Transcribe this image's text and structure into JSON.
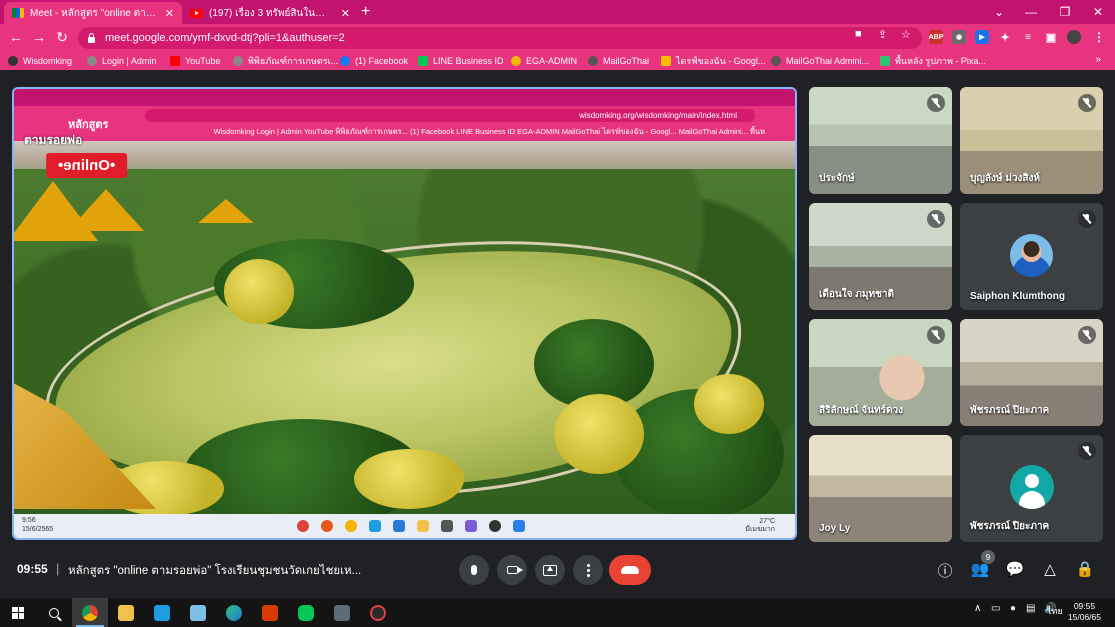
{
  "browser": {
    "tabs": [
      {
        "title": "Meet - หลักสูตร \"online ตามรอยพ่อ\"",
        "icon": "meet-icon",
        "active": true
      },
      {
        "title": "(197) เรื่อง 3 ทรัพย์สินในน้ำ - YouTube",
        "icon": "youtube-icon",
        "active": false
      }
    ],
    "new_tab": "+",
    "window_controls": [
      "⌄",
      "—",
      "❐",
      "✕"
    ],
    "url": "meet.google.com/ymf-dxvd-dtj?pli=1&authuser=2",
    "bookmarks": [
      {
        "label": "Wisdomking",
        "icon": "wisdomking-icon",
        "color": "#333333"
      },
      {
        "label": "Login | Admin",
        "icon": "globe-icon",
        "color": "#888888"
      },
      {
        "label": "YouTube",
        "icon": "youtube-icon",
        "color": "#ff0000"
      },
      {
        "label": "พิพิธภัณฑ์การเกษตรเ...",
        "icon": "globe-icon",
        "color": "#888888"
      },
      {
        "label": "(1) Facebook",
        "icon": "facebook-icon",
        "color": "#1877f2"
      },
      {
        "label": "LINE Business ID",
        "icon": "line-icon",
        "color": "#06c755"
      },
      {
        "label": "EGA-ADMIN",
        "icon": "ega-icon",
        "color": "#f2b705"
      },
      {
        "label": "MailGoThai",
        "icon": "mailgothai-icon",
        "color": "#555555"
      },
      {
        "label": "ไดรฟ์ของฉัน - Googl...",
        "icon": "drive-icon",
        "color": "#fbbc04"
      },
      {
        "label": "MailGoThai Admini...",
        "icon": "mailgothai-icon",
        "color": "#555555"
      },
      {
        "label": "พื้นหลัง รูปภาพ - Pixa...",
        "icon": "pixabay-icon",
        "color": "#2ec66d"
      }
    ],
    "bookmarks_more": "»"
  },
  "presentation": {
    "badge_text": "•Online•",
    "shared_title": "หลักสูตร",
    "shared_subtitle": "ตามรอยพ่อ",
    "shared_url": "wisdomking.org/wisdomking/main/index.html",
    "shared_bookmarks": "Wisdomking   Login | Admin   YouTube   พิพิธภัณฑ์การเกษตร...   (1) Facebook   LINE Business ID   EGA-ADMIN   MailGoThai   ไดรฟ์ของฉัน - Googl...   MailGoThai Admini...   พื้นห",
    "shared_time": "9:56\n15/6/2565",
    "shared_weather": "27°C\nมีเมฆมาก"
  },
  "participants": [
    {
      "name": "ประจักษ์",
      "muted": true,
      "view": "classroom"
    },
    {
      "name": "บุญลังษ์ ม่วงสิงห์",
      "muted": true,
      "view": "classroom"
    },
    {
      "name": "เดือนใจ ภมุทชาติ",
      "muted": true,
      "view": "classroom"
    },
    {
      "name": "Saiphon Klumthong",
      "muted": true,
      "view": "avatar-photo"
    },
    {
      "name": "สิริลักษณ์ จันทร์ดวง",
      "muted": true,
      "view": "person"
    },
    {
      "name": "พัชรภรณ์ ปิยะภาค",
      "muted": true,
      "view": "classroom"
    },
    {
      "name": "Joy Ly",
      "muted": false,
      "view": "classroom"
    },
    {
      "name": "พัชรภรณ์ ปิยะภาค",
      "muted": true,
      "view": "avatar-generic"
    }
  ],
  "meeting": {
    "time": "09:55",
    "separator": "|",
    "title": "หลักสูตร \"online ตามรอยพ่อ\" โรงเรียนชุมชนวัดเกยไชยเห...",
    "participant_count": "9",
    "leave_color": "#ea4335"
  },
  "taskbar": {
    "apps": [
      "start-icon",
      "search-icon",
      "chrome-icon",
      "file-explorer-icon",
      "line-app-icon",
      "notepad-icon",
      "edge-icon",
      "office-icon",
      "line-icon",
      "calculator-icon",
      "recorder-icon"
    ],
    "tray_lang": "ไทย",
    "clock_time": "09:55",
    "clock_date": "15/06/65"
  }
}
